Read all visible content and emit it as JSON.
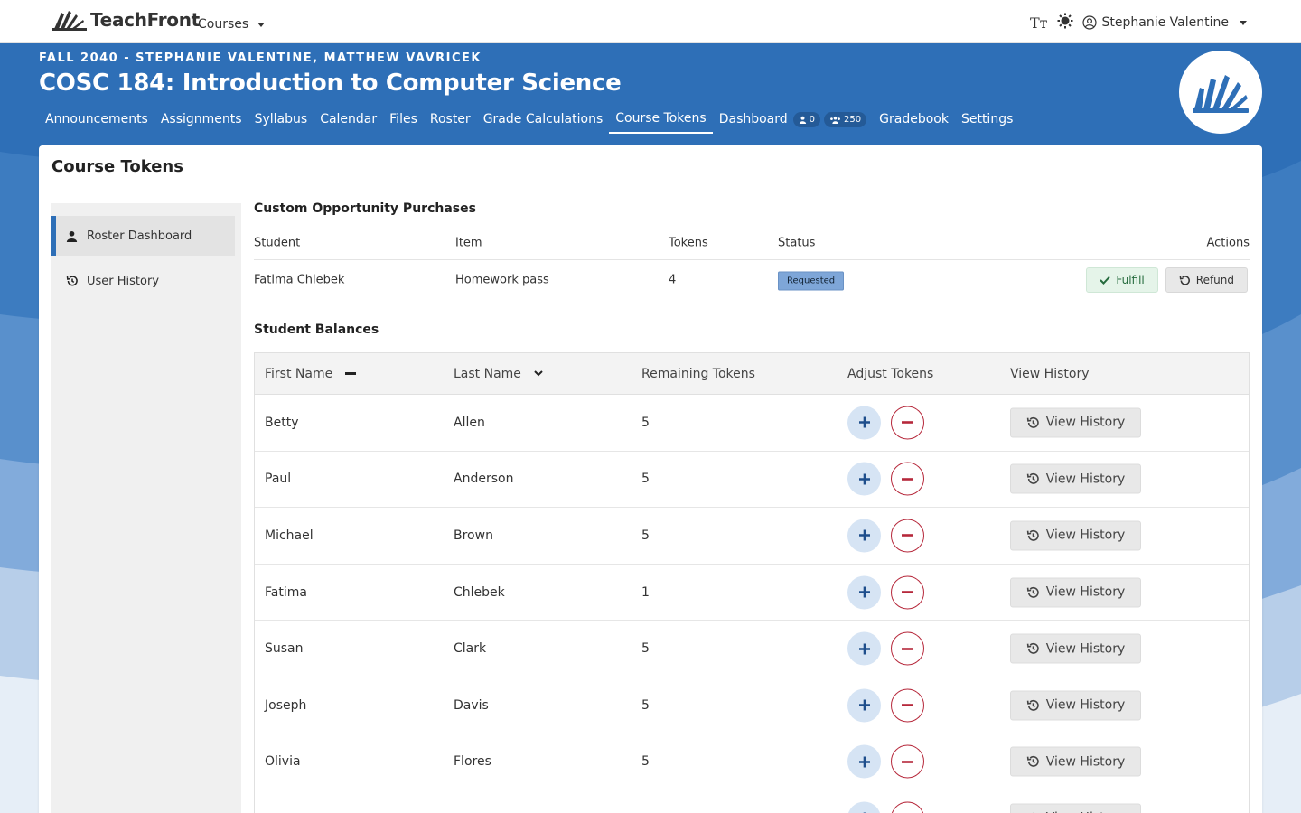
{
  "topbar": {
    "brand": "TeachFront",
    "courses_label": "Courses",
    "user_name": "Stephanie Valentine",
    "text_size_icon": "Tт"
  },
  "header": {
    "term": "FALL 2040 - STEPHANIE VALENTINE, MATTHEW VAVRICEK",
    "title": "COSC 184: Introduction to Computer Science",
    "nav": [
      {
        "label": "Announcements"
      },
      {
        "label": "Assignments"
      },
      {
        "label": "Syllabus"
      },
      {
        "label": "Calendar"
      },
      {
        "label": "Files"
      },
      {
        "label": "Roster"
      },
      {
        "label": "Grade Calculations"
      },
      {
        "label": "Course Tokens",
        "active": true
      },
      {
        "label": "Dashboard"
      },
      {
        "label": "Gradebook"
      },
      {
        "label": "Settings"
      }
    ],
    "dashboard_badges": {
      "user_count": "0",
      "group_count": "250"
    }
  },
  "page": {
    "title": "Course Tokens",
    "sidebar": [
      {
        "label": "Roster Dashboard",
        "active": true
      },
      {
        "label": "User History"
      }
    ]
  },
  "purchases": {
    "title": "Custom Opportunity Purchases",
    "headers": {
      "student": "Student",
      "item": "Item",
      "tokens": "Tokens",
      "status": "Status",
      "actions": "Actions"
    },
    "rows": [
      {
        "student": "Fatima Chlebek",
        "item": "Homework pass",
        "tokens": "4",
        "status": "Requested"
      }
    ],
    "fulfill_label": "Fulfill",
    "refund_label": "Refund"
  },
  "balances": {
    "title": "Student Balances",
    "headers": {
      "first_name": "First Name",
      "last_name": "Last Name",
      "remaining": "Remaining Tokens",
      "adjust": "Adjust Tokens",
      "history": "View History"
    },
    "view_history_label": "View History",
    "rows": [
      {
        "first": "Betty",
        "last": "Allen",
        "tokens": "5"
      },
      {
        "first": "Paul",
        "last": "Anderson",
        "tokens": "5"
      },
      {
        "first": "Michael",
        "last": "Brown",
        "tokens": "5"
      },
      {
        "first": "Fatima",
        "last": "Chlebek",
        "tokens": "1"
      },
      {
        "first": "Susan",
        "last": "Clark",
        "tokens": "5"
      },
      {
        "first": "Joseph",
        "last": "Davis",
        "tokens": "5"
      },
      {
        "first": "Olivia",
        "last": "Flores",
        "tokens": "5"
      },
      {
        "first": "",
        "last": "",
        "tokens": ""
      }
    ]
  },
  "colors": {
    "brand_blue": "#2e6fb7",
    "danger": "#b6283b",
    "success": "#256b3d",
    "status_badge": "#7ea6d8"
  }
}
